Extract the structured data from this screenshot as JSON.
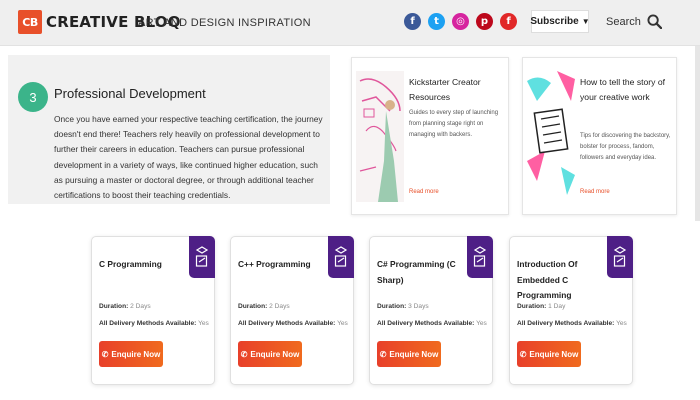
{
  "header": {
    "logo_badge": "CB",
    "logo_text": "CREATIVE BLOQ",
    "tagline": "ART AND DESIGN INSPIRATION",
    "socials": [
      {
        "name": "facebook",
        "glyph": "f",
        "color": "#3b5998"
      },
      {
        "name": "twitter",
        "glyph": "t",
        "color": "#1da1f2"
      },
      {
        "name": "instagram",
        "glyph": "◎",
        "color": "#d6249f"
      },
      {
        "name": "pinterest",
        "glyph": "p",
        "color": "#bd081c"
      },
      {
        "name": "flipboard",
        "glyph": "f",
        "color": "#e12828"
      }
    ],
    "subscribe_label": "Subscribe",
    "search_label": "Search"
  },
  "panel": {
    "step_number": "3",
    "title": "Professional Development",
    "body": "Once you have earned your respective teaching certification, the journey doesn't end there! Teachers rely heavily on professional development to further their careers in education. Teachers can pursue professional development in a variety of ways, like continued higher education, such as pursuing a master or doctoral degree, or through additional teacher certifications to boost their teaching credentials."
  },
  "articles": [
    {
      "title": "Kickstarter Creator Resources",
      "desc": "Guides to every step of launching from planning stage right on managing with backers.",
      "read_more": "Read more"
    },
    {
      "title": "How to tell the story of your creative work",
      "desc": "Tips for discovering the backstory, bolster for process, fandom, followers and everyday idea.",
      "read_more": "Read more"
    }
  ],
  "courses": [
    {
      "title": "C Programming",
      "duration_label": "Duration:",
      "duration": "2 Days",
      "methods_label": "All Delivery Methods Available:",
      "methods": "Yes",
      "button": "Enquire Now"
    },
    {
      "title": "C++ Programming",
      "duration_label": "Duration:",
      "duration": "2 Days",
      "methods_label": "All Delivery Methods Available:",
      "methods": "Yes",
      "button": "Enquire Now"
    },
    {
      "title": "C# Programming (C Sharp)",
      "duration_label": "Duration:",
      "duration": "3 Days",
      "methods_label": "All Delivery Methods Available:",
      "methods": "Yes",
      "button": "Enquire Now"
    },
    {
      "title": "Introduction Of Embedded C Programming",
      "duration_label": "Duration:",
      "duration": "1 Day",
      "methods_label": "All Delivery Methods Available:",
      "methods": "Yes",
      "button": "Enquire Now"
    }
  ],
  "colors": {
    "brand_orange": "#e8502a",
    "step_green": "#3bb48a",
    "course_purple": "#4e1f86"
  }
}
